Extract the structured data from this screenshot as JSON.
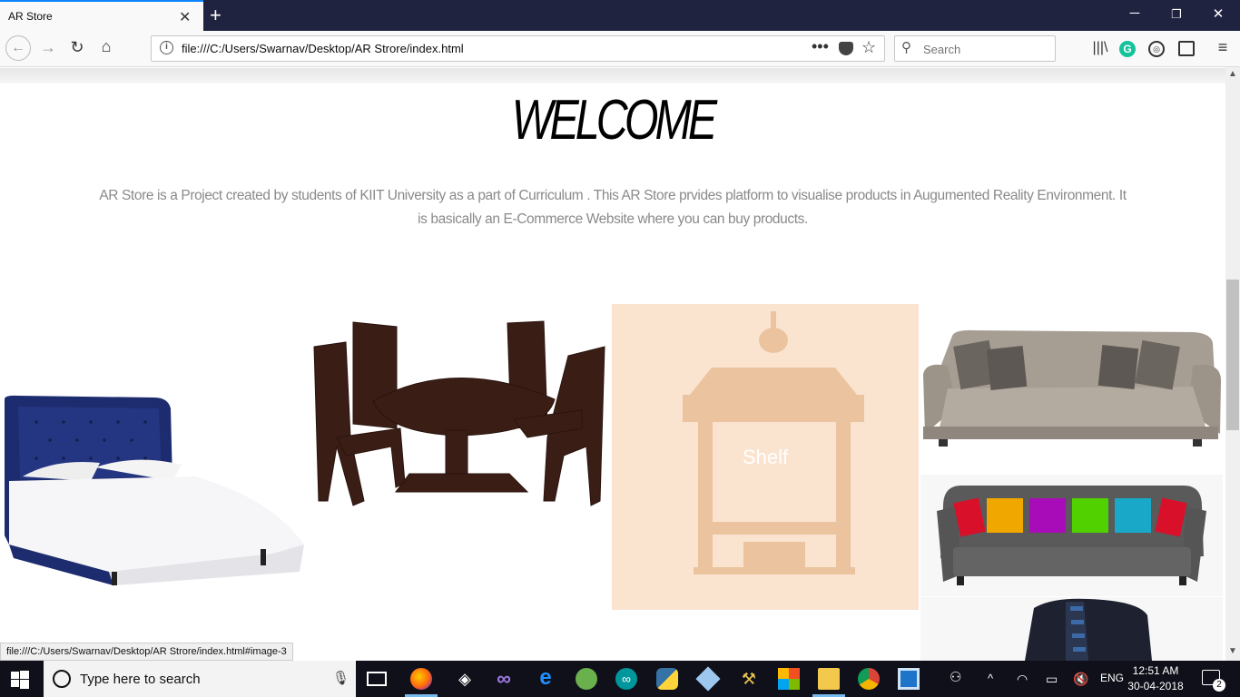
{
  "browser": {
    "tab_title": "AR Store",
    "url": "file:///C:/Users/Swarnav/Desktop/AR Strore/index.html",
    "search_placeholder": "Search"
  },
  "page": {
    "heading": "WELCOME",
    "description": "AR Store is a Project created by students of KIIT University as a part of Curriculum . This AR Store prvides platform to visualise products in Augumented Reality Environment. It is basically an E-Commerce Website where you can buy products.",
    "products": [
      {
        "name": "bed",
        "label": ""
      },
      {
        "name": "dining-table",
        "label": ""
      },
      {
        "name": "shelf",
        "label": "Shelf"
      },
      {
        "name": "grey-sofa",
        "label": ""
      },
      {
        "name": "black-sofa",
        "label": ""
      },
      {
        "name": "chair",
        "label": ""
      }
    ]
  },
  "status_bar": {
    "text": "file:///C:/Users/Swarnav/Desktop/AR Strore/index.html#image-3"
  },
  "taskbar": {
    "search_placeholder": "Type here to search",
    "language": "ENG",
    "time": "12:51 AM",
    "date": "30-04-2018",
    "notification_count": "2"
  },
  "colors": {
    "titlebar": "#202340",
    "shelf_overlay": "#fae4d0",
    "description_text": "#8a8a8a"
  }
}
